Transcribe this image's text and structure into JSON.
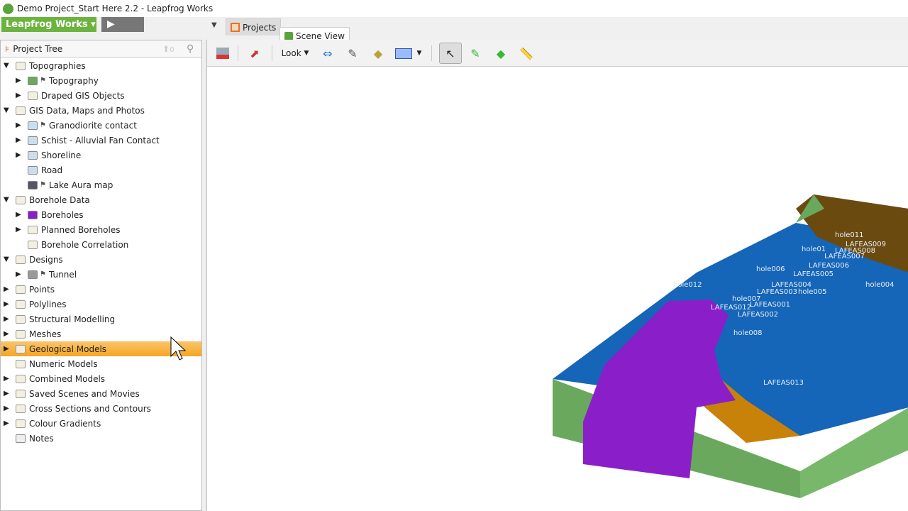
{
  "window": {
    "title": "Demo Project_Start Here 2.2 - Leapfrog Works"
  },
  "appbar": {
    "brand_button": "Leapfrog Works ▾",
    "play_icon": "play-icon"
  },
  "tabs": [
    {
      "label": "Projects",
      "icon": "grid-icon"
    },
    {
      "label": "Scene View",
      "icon": "cube-icon",
      "active": true
    }
  ],
  "panel": {
    "title": "Project Tree",
    "sort_count": "0"
  },
  "tree": [
    {
      "label": "Topographies",
      "level": 0,
      "expanded": true,
      "icon": "folder"
    },
    {
      "label": "Topography",
      "level": 1,
      "expanded": false,
      "icon": "topography",
      "flag": true
    },
    {
      "label": "Draped GIS Objects",
      "level": 1,
      "expanded": false,
      "icon": "folder"
    },
    {
      "label": "GIS Data, Maps and Photos",
      "level": 0,
      "expanded": true,
      "icon": "folder"
    },
    {
      "label": "Granodiorite contact",
      "level": 1,
      "expanded": false,
      "icon": "gis",
      "flag": true
    },
    {
      "label": "Schist - Alluvial Fan Contact",
      "level": 1,
      "expanded": false,
      "icon": "gis"
    },
    {
      "label": "Shoreline",
      "level": 1,
      "expanded": false,
      "icon": "gis"
    },
    {
      "label": "Road",
      "level": 1,
      "icon": "gis"
    },
    {
      "label": "Lake Aura map",
      "level": 1,
      "icon": "image",
      "flag": true
    },
    {
      "label": "Borehole Data",
      "level": 0,
      "expanded": true,
      "icon": "folder"
    },
    {
      "label": "Boreholes",
      "level": 1,
      "expanded": false,
      "icon": "boreholes"
    },
    {
      "label": "Planned Boreholes",
      "level": 1,
      "expanded": false,
      "icon": "folder"
    },
    {
      "label": "Borehole Correlation",
      "level": 1,
      "icon": "folder"
    },
    {
      "label": "Designs",
      "level": 0,
      "expanded": true,
      "icon": "folder"
    },
    {
      "label": "Tunnel",
      "level": 1,
      "expanded": false,
      "icon": "tunnel",
      "flag": true
    },
    {
      "label": "Points",
      "level": 0,
      "expanded": false,
      "icon": "folder"
    },
    {
      "label": "Polylines",
      "level": 0,
      "expanded": false,
      "icon": "folder"
    },
    {
      "label": "Structural Modelling",
      "level": 0,
      "expanded": false,
      "icon": "folder"
    },
    {
      "label": "Meshes",
      "level": 0,
      "expanded": false,
      "icon": "folder"
    },
    {
      "label": "Geological Models",
      "level": 0,
      "expanded": false,
      "icon": "folder",
      "selected": true
    },
    {
      "label": "Numeric Models",
      "level": 0,
      "icon": "folder"
    },
    {
      "label": "Combined Models",
      "level": 0,
      "expanded": false,
      "icon": "folder"
    },
    {
      "label": "Saved Scenes and Movies",
      "level": 0,
      "expanded": false,
      "icon": "folder"
    },
    {
      "label": "Cross Sections and Contours",
      "level": 0,
      "expanded": false,
      "icon": "folder"
    },
    {
      "label": "Colour Gradients",
      "level": 0,
      "expanded": false,
      "icon": "folder"
    },
    {
      "label": "Notes",
      "level": 0,
      "icon": "notes"
    }
  ],
  "toolbar": {
    "look_label": "Look"
  },
  "scene_labels": [
    "hole011",
    "LAFEAS009",
    "hole01",
    "LAFEAS008",
    "LAFEAS007",
    "LAFEAS006",
    "hole006",
    "LAFEAS005",
    "hole012",
    "LAFEAS004",
    "hole004",
    "LAFEAS003",
    "hole005",
    "hole007",
    "LAFEAS012",
    "LAFEAS001",
    "LAFEAS002",
    "hole008",
    "LAFEAS013"
  ],
  "colors": {
    "brand": "#6cb33f",
    "selection": "#f5a623",
    "lake": "#1565b8",
    "granite": "#8a1fc9",
    "schist": "#6aa85e",
    "alluvial": "#c8820a",
    "topo_brown": "#6b4a10"
  }
}
